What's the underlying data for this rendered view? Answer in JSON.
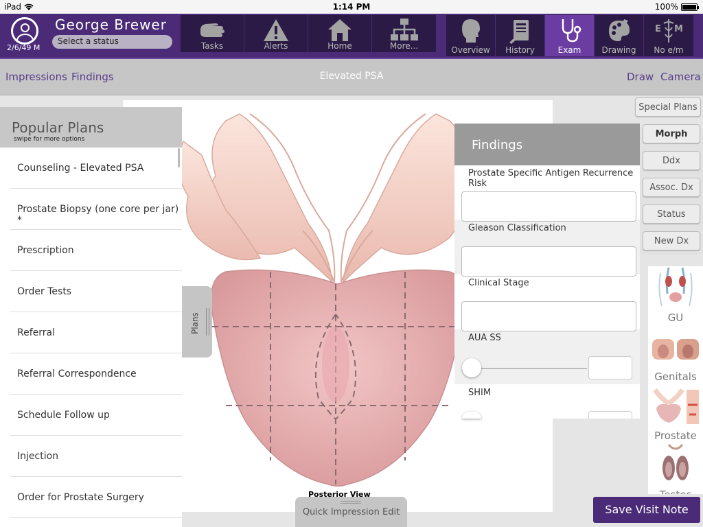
{
  "status_bar": {
    "device": "iPad",
    "time": "1:14 PM",
    "battery": "100%",
    "battery_level": 1.0
  },
  "patient": {
    "name": "George  Brewer",
    "dob": "2/6/49 M",
    "status_placeholder": "Select a status"
  },
  "nav_left": [
    {
      "label": "Tasks",
      "icon": "hand-icon"
    },
    {
      "label": "Alerts",
      "icon": "alert-icon"
    },
    {
      "label": "Home",
      "icon": "home-icon"
    },
    {
      "label": "More...",
      "icon": "sitemap-icon"
    }
  ],
  "nav_right": [
    {
      "label": "Overview",
      "icon": "head-icon"
    },
    {
      "label": "History",
      "icon": "clipboard-icon"
    },
    {
      "label": "Exam",
      "icon": "stethoscope-icon",
      "active": true
    },
    {
      "label": "Drawing",
      "icon": "palette-icon"
    },
    {
      "label": "No e/m",
      "icon": "caduceus-icon"
    }
  ],
  "subheader": {
    "impressions": "Impressions",
    "findings": "Findings",
    "title": "Elevated PSA",
    "draw": "Draw",
    "camera": "Camera"
  },
  "popular_plans": {
    "title": "Popular Plans",
    "subtitle": "swipe for more options",
    "items": [
      "Counseling - Elevated PSA",
      "Prostate Biopsy (one core per jar) *",
      "Prescription",
      "Order Tests",
      "Referral",
      "Referral Correspondence",
      "Schedule Follow up",
      "Injection",
      "Order for Prostate Surgery"
    ],
    "tab_label": "Plans"
  },
  "canvas": {
    "caption": "Posterior View"
  },
  "findings": {
    "title": "Findings",
    "fields": {
      "psa": "Prostate Specific Antigen Recurrence Risk",
      "gleason": "Gleason Classification",
      "stage": "Clinical Stage",
      "aua": "AUA SS",
      "shim": "SHIM"
    }
  },
  "right_buttons": {
    "special_plans": "Special Plans",
    "morph": "Morph",
    "ddx": "Ddx",
    "assoc_dx": "Assoc. Dx",
    "status": "Status",
    "new_dx": "New Dx"
  },
  "thumbnails": [
    "GU",
    "Genitals",
    "Prostate",
    "Testes"
  ],
  "footer": {
    "quick_impression": "Quick Impression Edit",
    "save": "Save Visit Note"
  },
  "colors": {
    "brand": "#4b2a78",
    "accent": "#6b3da3",
    "link": "#5a3d8a",
    "tissue": "#e8b4b4"
  }
}
